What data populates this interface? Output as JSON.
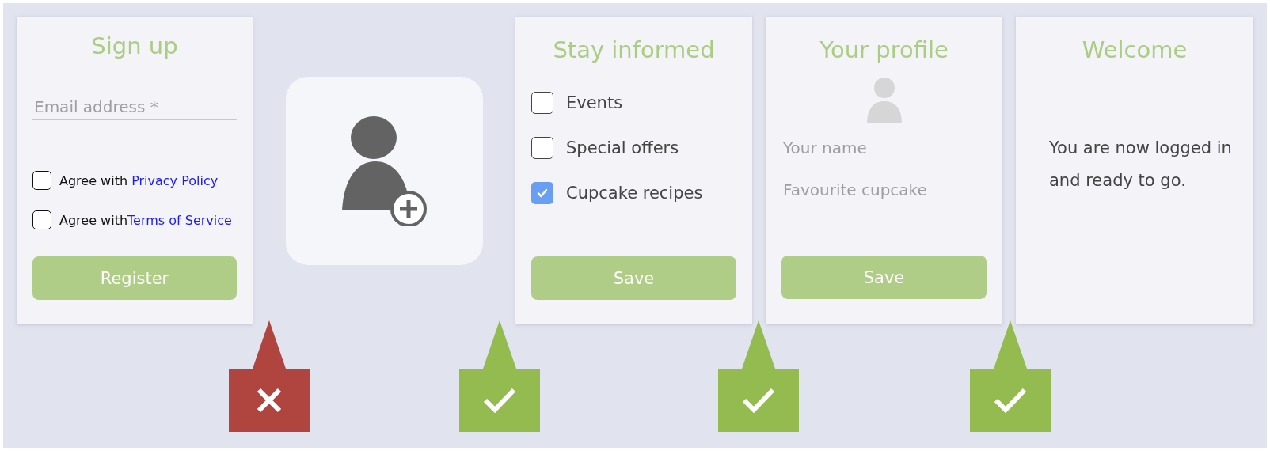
{
  "steps": [
    {
      "kind": "signup",
      "title": "Sign up",
      "field": {
        "placeholder": "Email address *"
      },
      "agreements": [
        {
          "text": "Agree with ",
          "link": "Privacy Policy",
          "checked": false
        },
        {
          "text": "Agree with",
          "link": "Terms of Service",
          "checked": false
        }
      ],
      "button": "Register"
    },
    {
      "kind": "avatar"
    },
    {
      "kind": "checklist",
      "title": "Stay informed",
      "options": [
        {
          "label": "Events",
          "checked": false
        },
        {
          "label": "Special offers",
          "checked": false
        },
        {
          "label": "Cupcake recipes",
          "checked": true
        }
      ],
      "button": "Save"
    },
    {
      "kind": "profile",
      "title": "Your profile",
      "fields": [
        {
          "placeholder": "Your name"
        },
        {
          "placeholder": "Favourite cupcake"
        }
      ],
      "button": "Save"
    },
    {
      "kind": "welcome",
      "title": "Welcome",
      "message": "You are now logged in and ready to go."
    }
  ],
  "markers": [
    {
      "passed": false
    },
    {
      "passed": true
    },
    {
      "passed": true
    },
    {
      "passed": true
    }
  ]
}
